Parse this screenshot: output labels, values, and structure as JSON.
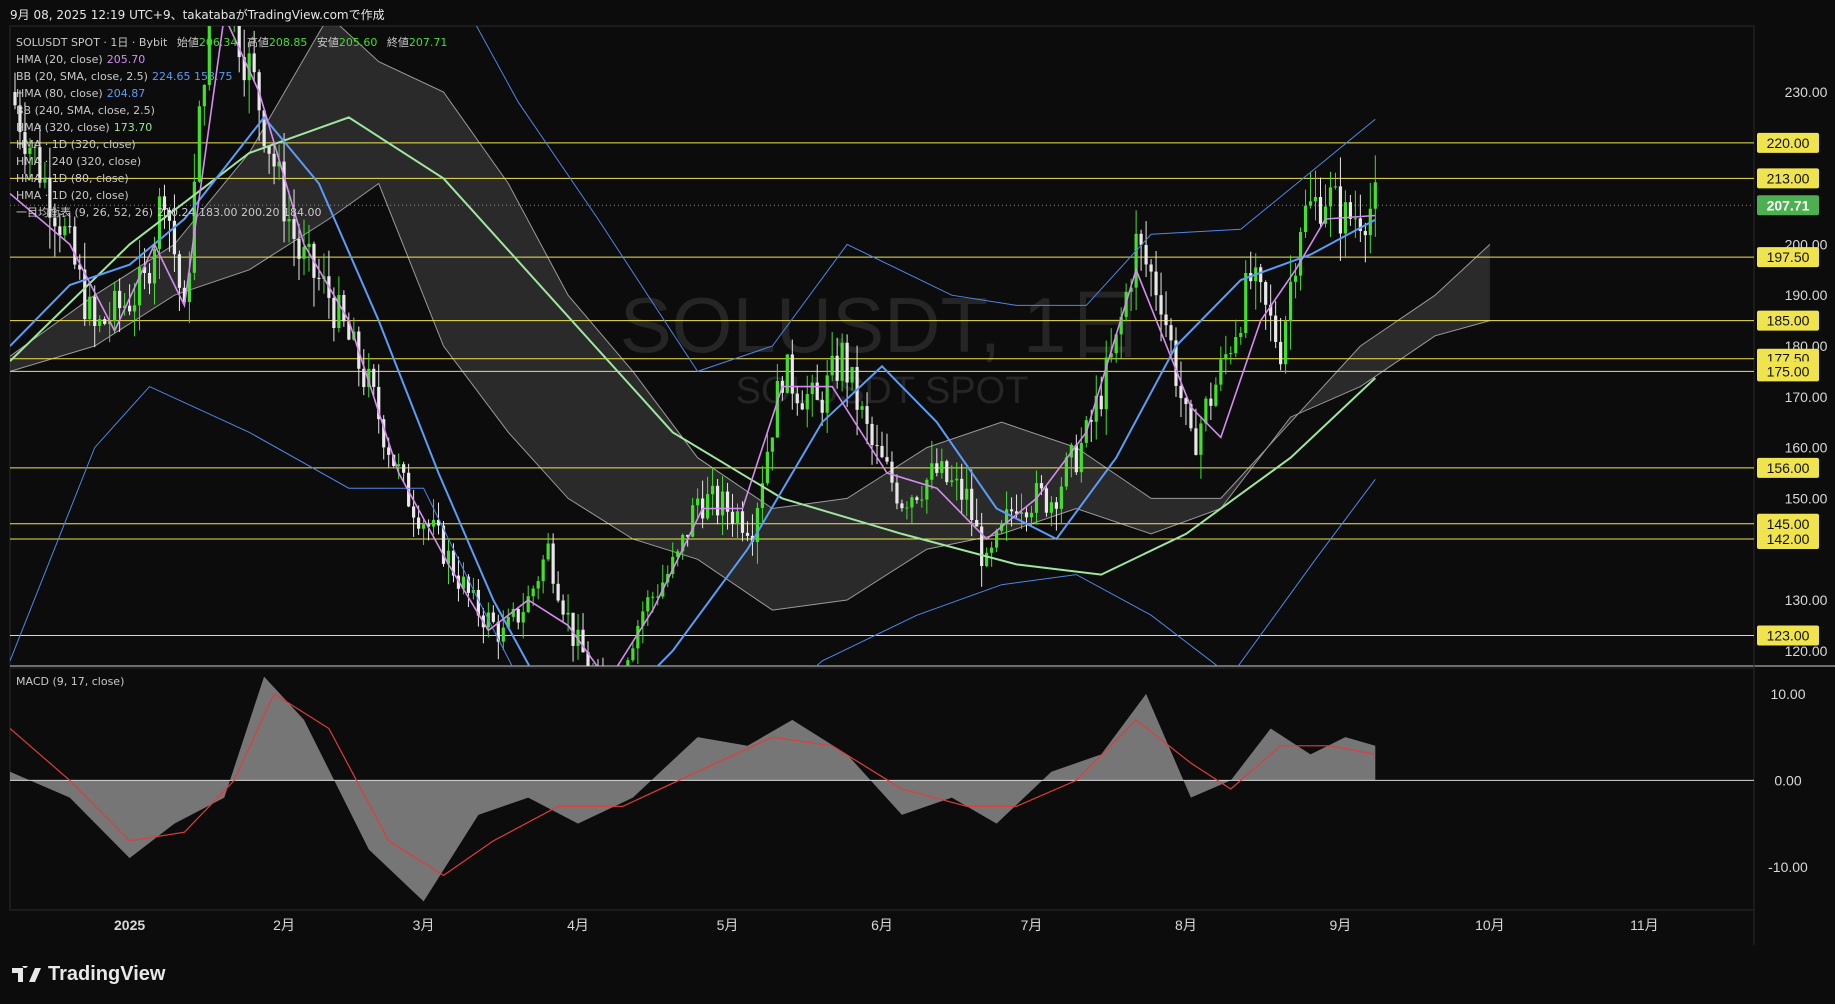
{
  "header": {
    "caption": "9月 08, 2025 12:19 UTC+9、takatabaがTradingView.comで作成"
  },
  "legend": {
    "title_prefix": "SOLUSDT SPOT · 1日 · Bybit",
    "open_label": "始値",
    "open": "206.34",
    "high_label": "高値",
    "high": "208.85",
    "low_label": "安値",
    "low": "205.60",
    "close_label": "終値",
    "close": "207.71",
    "indicators": [
      {
        "label": "HMA (20, close)",
        "value": "205.70",
        "color": "#d58cf0"
      },
      {
        "label": "BB (20, SMA, close, 2.5)",
        "value": "224.65  153.75",
        "color": "#5b9cf6"
      },
      {
        "label": "HMA (80, close)",
        "value": "204.87",
        "color": "#5b9cf6"
      },
      {
        "label": "BB (240, SMA, close, 2.5)",
        "value": "",
        "color": "#5b9cf6"
      },
      {
        "label": "HMA (320, close)",
        "value": "173.70",
        "color": "#9fe59f"
      },
      {
        "label": "HMA · 1D (320, close)",
        "value": "",
        "color": "#9fe59f"
      },
      {
        "label": "HMA · 240 (320, close)",
        "value": "",
        "color": "#9fe59f"
      },
      {
        "label": "HMA · 1D (80, close)",
        "value": "",
        "color": "#5b9cf6"
      },
      {
        "label": "HMA · 1D (20, close)",
        "value": "",
        "color": "#d58cf0"
      },
      {
        "label": "一目均衡表 (9, 26, 52, 26)",
        "value": "210.24  183.00  200.20  184.00",
        "color": "#aaaaaa"
      }
    ]
  },
  "watermark": {
    "symbol": "SOLUSDT, 1日",
    "sub": "SOLUSDT SPOT"
  },
  "macd_label": "MACD (9, 17, close)",
  "brand": {
    "name": "TradingView"
  },
  "colors": {
    "background": "#0c0c0c",
    "up": "#42e02a",
    "down": "#e8e8e8",
    "hline": "#f0e44e",
    "price_tag": "#4caf50",
    "hma20": "#d58cf0",
    "hma80": "#5b9cf6",
    "hma320": "#9fe59f",
    "bb": "#4f86ea",
    "signal": "#e03c3c",
    "macd_fill": "#8a8a8a"
  },
  "chart_data": {
    "type": "candlestick",
    "symbol": "SOLUSDT",
    "interval": "1日",
    "price_axis": {
      "range": [
        117,
        243
      ],
      "ticks": [
        "230.00",
        "200.00",
        "190.00",
        "180.00",
        "170.00",
        "160.00",
        "150.00",
        "130.00",
        "120.00"
      ]
    },
    "horizontal_levels": [
      "220.00",
      "213.00",
      "197.50",
      "185.00",
      "177.50",
      "175.00",
      "156.00",
      "145.00",
      "142.00",
      "123.00"
    ],
    "last_price": "207.71",
    "time_axis": {
      "range": [
        "2024-12-08",
        "2025-11-23"
      ],
      "labels": [
        {
          "text": "2025",
          "date": "2025-01-01"
        },
        {
          "text": "2月",
          "date": "2025-02-01"
        },
        {
          "text": "3月",
          "date": "2025-03-01"
        },
        {
          "text": "4月",
          "date": "2025-04-01"
        },
        {
          "text": "5月",
          "date": "2025-05-01"
        },
        {
          "text": "6月",
          "date": "2025-06-01"
        },
        {
          "text": "7月",
          "date": "2025-07-01"
        },
        {
          "text": "8月",
          "date": "2025-08-01"
        },
        {
          "text": "9月",
          "date": "2025-09-01"
        },
        {
          "text": "10月",
          "date": "2025-10-01"
        },
        {
          "text": "11月",
          "date": "2025-11-01"
        }
      ]
    },
    "close_path": [
      [
        "2024-12-08",
        230
      ],
      [
        "2024-12-18",
        205
      ],
      [
        "2024-12-25",
        183
      ],
      [
        "2025-01-04",
        192
      ],
      [
        "2025-01-08",
        212
      ],
      [
        "2025-01-12",
        185
      ],
      [
        "2025-01-18",
        262
      ],
      [
        "2025-01-22",
        245
      ],
      [
        "2025-01-27",
        228
      ],
      [
        "2025-01-31",
        212
      ],
      [
        "2025-02-04",
        198
      ],
      [
        "2025-02-10",
        190
      ],
      [
        "2025-02-18",
        172
      ],
      [
        "2025-02-25",
        152
      ],
      [
        "2025-03-05",
        140
      ],
      [
        "2025-03-11",
        129
      ],
      [
        "2025-03-17",
        123
      ],
      [
        "2025-03-22",
        130
      ],
      [
        "2025-03-26",
        140
      ],
      [
        "2025-03-31",
        123
      ],
      [
        "2025-04-07",
        110
      ],
      [
        "2025-04-14",
        128
      ],
      [
        "2025-04-21",
        138
      ],
      [
        "2025-04-25",
        150
      ],
      [
        "2025-05-01",
        148
      ],
      [
        "2025-05-06",
        145
      ],
      [
        "2025-05-12",
        175
      ],
      [
        "2025-05-19",
        168
      ],
      [
        "2025-05-24",
        178
      ],
      [
        "2025-05-30",
        160
      ],
      [
        "2025-06-05",
        150
      ],
      [
        "2025-06-12",
        155
      ],
      [
        "2025-06-18",
        150
      ],
      [
        "2025-06-22",
        136
      ],
      [
        "2025-06-28",
        150
      ],
      [
        "2025-07-05",
        150
      ],
      [
        "2025-07-12",
        162
      ],
      [
        "2025-07-18",
        180
      ],
      [
        "2025-07-22",
        200
      ],
      [
        "2025-07-27",
        190
      ],
      [
        "2025-08-02",
        160
      ],
      [
        "2025-08-08",
        175
      ],
      [
        "2025-08-14",
        193
      ],
      [
        "2025-08-20",
        180
      ],
      [
        "2025-08-24",
        205
      ],
      [
        "2025-08-29",
        210
      ],
      [
        "2025-09-02",
        205
      ],
      [
        "2025-09-08",
        207.71
      ]
    ],
    "hma20_path": [
      [
        "2024-12-08",
        210
      ],
      [
        "2024-12-20",
        200
      ],
      [
        "2024-12-29",
        183
      ],
      [
        "2025-01-06",
        200
      ],
      [
        "2025-01-12",
        188
      ],
      [
        "2025-01-20",
        245
      ],
      [
        "2025-01-27",
        230
      ],
      [
        "2025-02-05",
        200
      ],
      [
        "2025-02-14",
        185
      ],
      [
        "2025-02-24",
        155
      ],
      [
        "2025-03-06",
        137
      ],
      [
        "2025-03-14",
        124
      ],
      [
        "2025-03-22",
        130
      ],
      [
        "2025-03-30",
        125
      ],
      [
        "2025-04-07",
        114
      ],
      [
        "2025-04-16",
        128
      ],
      [
        "2025-04-26",
        148
      ],
      [
        "2025-05-04",
        148
      ],
      [
        "2025-05-12",
        172
      ],
      [
        "2025-05-22",
        172
      ],
      [
        "2025-06-02",
        155
      ],
      [
        "2025-06-12",
        152
      ],
      [
        "2025-06-22",
        142
      ],
      [
        "2025-07-02",
        150
      ],
      [
        "2025-07-12",
        163
      ],
      [
        "2025-07-22",
        195
      ],
      [
        "2025-08-02",
        168
      ],
      [
        "2025-08-08",
        162
      ],
      [
        "2025-08-16",
        185
      ],
      [
        "2025-08-23",
        195
      ],
      [
        "2025-08-29",
        205
      ],
      [
        "2025-09-08",
        205.7
      ]
    ],
    "hma80_path": [
      [
        "2024-12-08",
        180
      ],
      [
        "2024-12-20",
        192
      ],
      [
        "2025-01-01",
        196
      ],
      [
        "2025-01-12",
        205
      ],
      [
        "2025-01-20",
        215
      ],
      [
        "2025-01-28",
        225
      ],
      [
        "2025-02-08",
        212
      ],
      [
        "2025-02-20",
        185
      ],
      [
        "2025-03-04",
        155
      ],
      [
        "2025-03-15",
        130
      ],
      [
        "2025-03-25",
        112
      ],
      [
        "2025-04-06",
        106
      ],
      [
        "2025-04-20",
        120
      ],
      [
        "2025-05-05",
        140
      ],
      [
        "2025-05-20",
        165
      ],
      [
        "2025-06-01",
        176
      ],
      [
        "2025-06-12",
        165
      ],
      [
        "2025-06-24",
        148
      ],
      [
        "2025-07-06",
        142
      ],
      [
        "2025-07-18",
        158
      ],
      [
        "2025-07-30",
        180
      ],
      [
        "2025-08-12",
        193
      ],
      [
        "2025-08-26",
        198
      ],
      [
        "2025-09-08",
        204.87
      ]
    ],
    "hma320_path": [
      [
        "2024-12-08",
        177
      ],
      [
        "2025-01-01",
        200
      ],
      [
        "2025-01-25",
        218
      ],
      [
        "2025-02-14",
        225
      ],
      [
        "2025-03-05",
        213
      ],
      [
        "2025-03-28",
        188
      ],
      [
        "2025-04-20",
        163
      ],
      [
        "2025-05-12",
        150
      ],
      [
        "2025-06-05",
        143
      ],
      [
        "2025-06-28",
        137
      ],
      [
        "2025-07-15",
        135
      ],
      [
        "2025-08-01",
        143
      ],
      [
        "2025-08-22",
        158
      ],
      [
        "2025-09-08",
        173.7
      ]
    ],
    "bb_upper_path": [
      [
        "2024-12-08",
        290
      ],
      [
        "2025-01-01",
        290
      ],
      [
        "2025-02-01",
        290
      ],
      [
        "2025-03-01",
        262
      ],
      [
        "2025-03-20",
        228
      ],
      [
        "2025-04-05",
        205
      ],
      [
        "2025-04-25",
        175
      ],
      [
        "2025-05-10",
        180
      ],
      [
        "2025-05-25",
        200
      ],
      [
        "2025-06-15",
        190
      ],
      [
        "2025-06-28",
        188
      ],
      [
        "2025-07-12",
        188
      ],
      [
        "2025-07-25",
        202
      ],
      [
        "2025-08-12",
        203
      ],
      [
        "2025-08-27",
        215
      ],
      [
        "2025-09-08",
        224.65
      ]
    ],
    "bb_lower_path": [
      [
        "2024-12-08",
        118
      ],
      [
        "2024-12-25",
        160
      ],
      [
        "2025-01-05",
        172
      ],
      [
        "2025-01-25",
        163
      ],
      [
        "2025-02-14",
        152
      ],
      [
        "2025-03-01",
        152
      ],
      [
        "2025-03-12",
        130
      ],
      [
        "2025-03-25",
        105
      ],
      [
        "2025-04-15",
        90
      ],
      [
        "2025-05-05",
        105
      ],
      [
        "2025-05-20",
        118
      ],
      [
        "2025-06-08",
        127
      ],
      [
        "2025-06-25",
        133
      ],
      [
        "2025-07-10",
        135
      ],
      [
        "2025-07-25",
        127
      ],
      [
        "2025-08-10",
        115
      ],
      [
        "2025-08-27",
        138
      ],
      [
        "2025-09-08",
        153.75
      ]
    ],
    "cloud_upper_path": [
      [
        "2024-12-08",
        178
      ],
      [
        "2024-12-25",
        190
      ],
      [
        "2025-01-10",
        200
      ],
      [
        "2025-01-25",
        218
      ],
      [
        "2025-02-10",
        245
      ],
      [
        "2025-02-20",
        236
      ],
      [
        "2025-03-05",
        230
      ],
      [
        "2025-03-18",
        212
      ],
      [
        "2025-03-30",
        190
      ],
      [
        "2025-04-12",
        175
      ],
      [
        "2025-04-25",
        158
      ],
      [
        "2025-05-10",
        148
      ],
      [
        "2025-05-25",
        150
      ],
      [
        "2025-06-10",
        160
      ],
      [
        "2025-06-25",
        165
      ],
      [
        "2025-07-10",
        160
      ],
      [
        "2025-07-25",
        150
      ],
      [
        "2025-08-08",
        150
      ],
      [
        "2025-08-22",
        165
      ],
      [
        "2025-09-05",
        180
      ],
      [
        "2025-09-20",
        190
      ],
      [
        "2025-10-01",
        200
      ]
    ],
    "cloud_lower_path": [
      [
        "2024-12-08",
        175
      ],
      [
        "2024-12-25",
        180
      ],
      [
        "2025-01-10",
        190
      ],
      [
        "2025-01-25",
        195
      ],
      [
        "2025-02-10",
        205
      ],
      [
        "2025-02-20",
        212
      ],
      [
        "2025-03-05",
        180
      ],
      [
        "2025-03-18",
        163
      ],
      [
        "2025-03-30",
        150
      ],
      [
        "2025-04-12",
        142
      ],
      [
        "2025-04-25",
        138
      ],
      [
        "2025-05-10",
        128
      ],
      [
        "2025-05-25",
        130
      ],
      [
        "2025-06-10",
        140
      ],
      [
        "2025-06-25",
        143
      ],
      [
        "2025-07-10",
        148
      ],
      [
        "2025-07-25",
        143
      ],
      [
        "2025-08-08",
        148
      ],
      [
        "2025-08-22",
        166
      ],
      [
        "2025-09-05",
        172
      ],
      [
        "2025-09-20",
        182
      ],
      [
        "2025-10-01",
        185
      ]
    ],
    "macd": {
      "range": [
        -15,
        13
      ],
      "ticks": [
        "10.00",
        "0.00",
        "-10.00"
      ],
      "histogram_path": [
        [
          "2024-12-08",
          1
        ],
        [
          "2024-12-20",
          -2
        ],
        [
          "2025-01-01",
          -9
        ],
        [
          "2025-01-10",
          -5
        ],
        [
          "2025-01-20",
          -2
        ],
        [
          "2025-01-28",
          12
        ],
        [
          "2025-02-05",
          7
        ],
        [
          "2025-02-18",
          -8
        ],
        [
          "2025-03-01",
          -14
        ],
        [
          "2025-03-12",
          -4
        ],
        [
          "2025-03-22",
          -2
        ],
        [
          "2025-04-01",
          -5
        ],
        [
          "2025-04-12",
          -2
        ],
        [
          "2025-04-25",
          5
        ],
        [
          "2025-05-05",
          4
        ],
        [
          "2025-05-14",
          7
        ],
        [
          "2025-05-25",
          3
        ],
        [
          "2025-06-05",
          -4
        ],
        [
          "2025-06-15",
          -2
        ],
        [
          "2025-06-24",
          -5
        ],
        [
          "2025-07-05",
          1
        ],
        [
          "2025-07-15",
          3
        ],
        [
          "2025-07-24",
          10
        ],
        [
          "2025-08-02",
          -2
        ],
        [
          "2025-08-10",
          0
        ],
        [
          "2025-08-18",
          6
        ],
        [
          "2025-08-26",
          3
        ],
        [
          "2025-09-02",
          5
        ],
        [
          "2025-09-08",
          4
        ]
      ],
      "signal_path": [
        [
          "2024-12-08",
          6
        ],
        [
          "2024-12-20",
          0
        ],
        [
          "2025-01-01",
          -7
        ],
        [
          "2025-01-12",
          -6
        ],
        [
          "2025-01-22",
          0
        ],
        [
          "2025-01-30",
          10
        ],
        [
          "2025-02-10",
          6
        ],
        [
          "2025-02-22",
          -7
        ],
        [
          "2025-03-05",
          -11
        ],
        [
          "2025-03-15",
          -7
        ],
        [
          "2025-03-28",
          -3
        ],
        [
          "2025-04-10",
          -3
        ],
        [
          "2025-04-25",
          1
        ],
        [
          "2025-05-10",
          5
        ],
        [
          "2025-05-22",
          4
        ],
        [
          "2025-06-05",
          -1
        ],
        [
          "2025-06-18",
          -3
        ],
        [
          "2025-06-28",
          -3
        ],
        [
          "2025-07-10",
          0
        ],
        [
          "2025-07-22",
          7
        ],
        [
          "2025-08-02",
          2
        ],
        [
          "2025-08-10",
          -1
        ],
        [
          "2025-08-20",
          4
        ],
        [
          "2025-08-30",
          4
        ],
        [
          "2025-09-08",
          3
        ]
      ]
    }
  }
}
